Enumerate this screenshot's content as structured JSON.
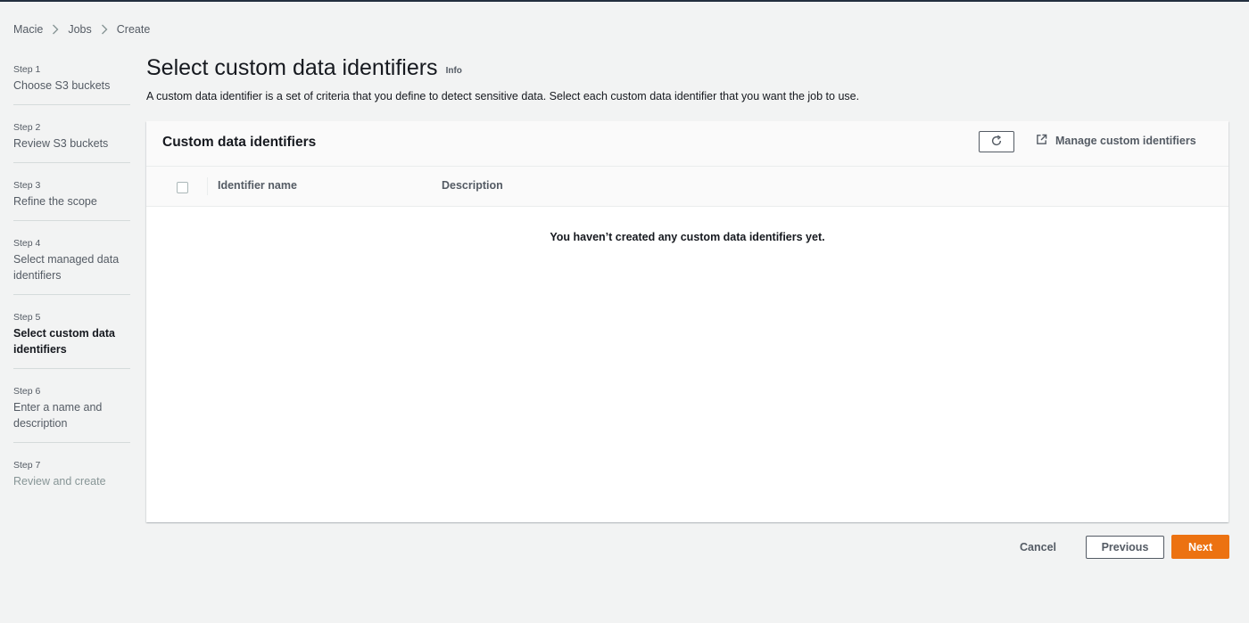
{
  "breadcrumb": [
    {
      "label": "Macie"
    },
    {
      "label": "Jobs"
    },
    {
      "label": "Create"
    }
  ],
  "steps": [
    {
      "number": "Step 1",
      "title": "Choose S3 buckets",
      "state": "completed"
    },
    {
      "number": "Step 2",
      "title": "Review S3 buckets",
      "state": "completed"
    },
    {
      "number": "Step 3",
      "title": "Refine the scope",
      "state": "completed"
    },
    {
      "number": "Step 4",
      "title": "Select managed data identifiers",
      "state": "completed"
    },
    {
      "number": "Step 5",
      "title": "Select custom data identifiers",
      "state": "active"
    },
    {
      "number": "Step 6",
      "title": "Enter a name and description",
      "state": "upcoming"
    },
    {
      "number": "Step 7",
      "title": "Review and create",
      "state": "disabled"
    }
  ],
  "page": {
    "title": "Select custom data identifiers",
    "info": "Info",
    "description": "A custom data identifier is a set of criteria that you define to detect sensitive data. Select each custom data identifier that you want the job to use."
  },
  "panel": {
    "title": "Custom data identifiers",
    "refresh_icon": "refresh-icon",
    "manage_label": "Manage custom identifiers",
    "manage_icon": "external-link-icon",
    "columns": [
      "Identifier name",
      "Description"
    ],
    "rows": [],
    "empty_message": "You haven’t created any custom data identifiers yet."
  },
  "actions": {
    "cancel": "Cancel",
    "previous": "Previous",
    "next": "Next"
  },
  "colors": {
    "primary": "#ec7211",
    "background": "#f2f3f3",
    "text_secondary": "#545b64"
  }
}
